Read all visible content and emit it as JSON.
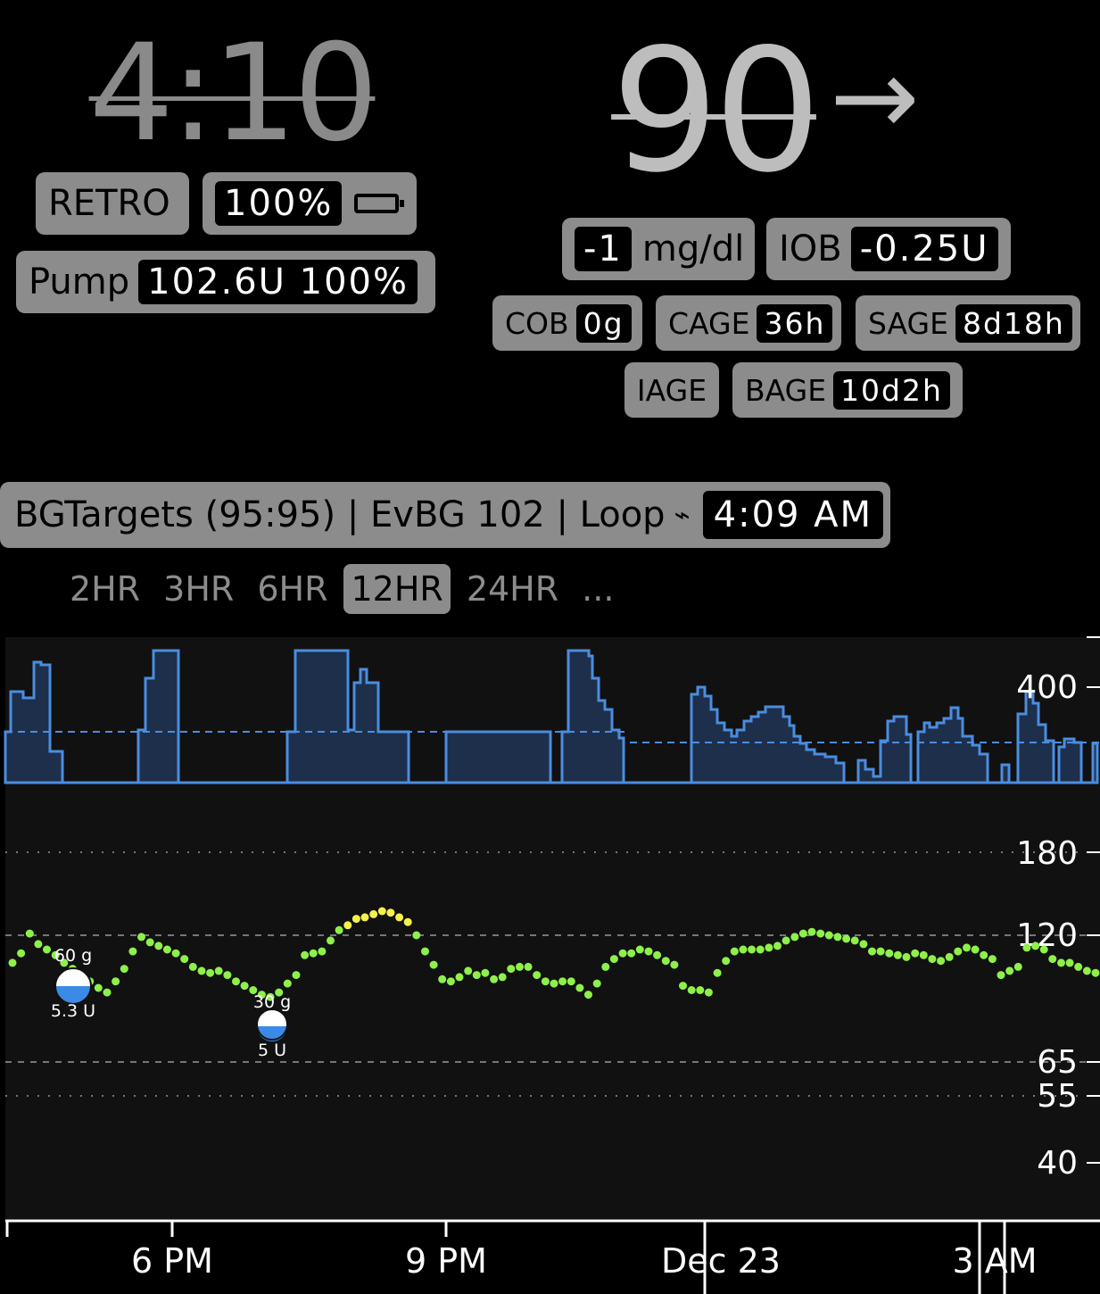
{
  "header": {
    "clock": "4:10",
    "bg": "90",
    "trend_arrow": "→"
  },
  "left_pills": {
    "retro_label": "RETRO",
    "battery_value": "100%",
    "pump_label": "Pump",
    "pump_value": "102.6U 100%"
  },
  "right_pills": {
    "delta_value": "-1",
    "delta_unit": "mg/dl",
    "iob_label": "IOB",
    "iob_value": "-0.25U",
    "cob_label": "COB",
    "cob_value": "0g",
    "cage_label": "CAGE",
    "cage_value": "36h",
    "sage_label": "SAGE",
    "sage_value": "8d18h",
    "iage_label": "IAGE",
    "bage_label": "BAGE",
    "bage_value": "10d2h"
  },
  "status_bar": {
    "text": "BGTargets (95:95) | EvBG 102 | Loop",
    "loop_icon": "lightning-icon",
    "time": "4:09 AM"
  },
  "time_ranges": {
    "items": [
      "2HR",
      "3HR",
      "6HR",
      "12HR",
      "24HR",
      "..."
    ],
    "selected": "12HR"
  },
  "chart_data": {
    "type": "scatter",
    "y_ticks": [
      400,
      180,
      120,
      65,
      55,
      40
    ],
    "x_ticks": [
      "6 PM",
      "9 PM",
      "Dec 23",
      "3 AM"
    ],
    "threshold_lines": [
      180,
      120,
      65,
      55
    ],
    "colors": {
      "in_range": "#8ef04a",
      "high": "#f7f04a",
      "basal": "#4a8de0",
      "basal_fill": "#1d2f4a",
      "background": "#111111"
    },
    "treatments": [
      {
        "carbs": "60 g",
        "insulin": "5.3 U"
      },
      {
        "carbs": "30 g",
        "insulin": "5 U"
      }
    ],
    "bg_points": [
      105,
      110,
      121,
      115,
      112,
      109,
      105,
      102,
      99,
      96,
      93,
      91,
      96,
      102,
      111,
      119,
      116,
      114,
      112,
      110,
      107,
      103,
      101,
      100,
      101,
      99,
      96,
      94,
      92,
      90,
      89,
      91,
      95,
      99,
      109,
      110,
      111,
      117,
      123,
      126,
      130,
      131,
      133,
      135,
      134,
      131,
      128,
      120,
      111,
      104,
      97,
      96,
      98,
      101,
      99,
      100,
      97,
      98,
      102,
      103,
      103,
      99,
      96,
      95,
      96,
      96,
      93,
      90,
      95,
      103,
      107,
      110,
      110,
      112,
      111,
      109,
      106,
      104,
      94,
      92,
      92,
      91,
      100,
      106,
      111,
      112,
      112,
      112,
      113,
      114,
      117,
      119,
      121,
      122,
      121,
      120,
      119,
      118,
      117,
      115,
      111,
      111,
      110,
      109,
      108,
      110,
      109,
      107,
      106,
      108,
      111,
      113,
      112,
      109,
      107,
      99,
      101,
      103,
      113,
      114,
      112,
      107,
      105,
      105,
      103,
      101,
      100
    ]
  }
}
